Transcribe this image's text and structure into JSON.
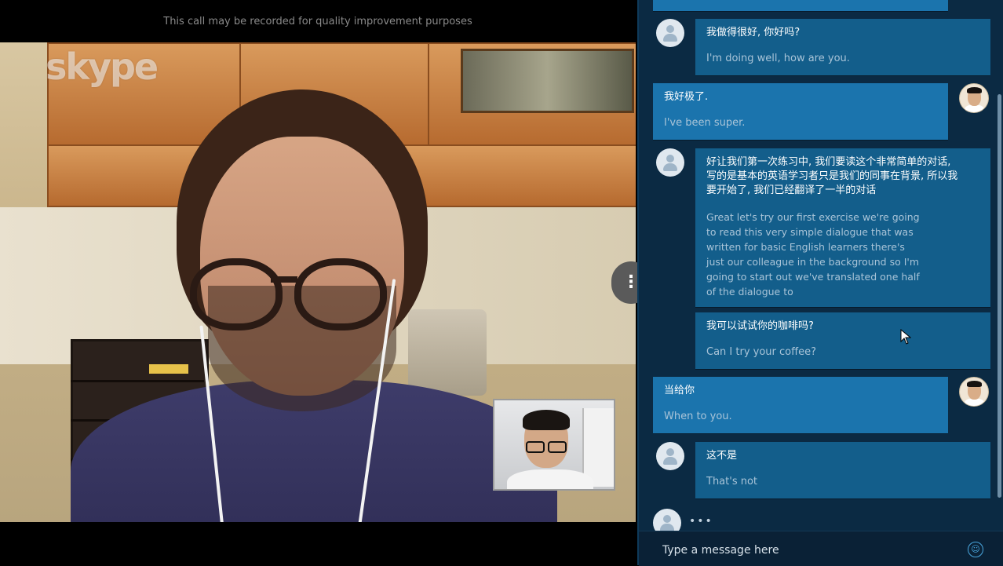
{
  "call": {
    "recording_notice": "This call may be recorded for quality improvement purposes",
    "watermark": "skype",
    "more_options_glyph": "⋮"
  },
  "chat": {
    "messages": [
      {
        "sender": "contact",
        "text": "我做得很好, 你好吗?",
        "translation": "I'm doing well, how are you."
      },
      {
        "sender": "self",
        "text": "我好极了.",
        "translation": "I've been super."
      },
      {
        "sender": "contact",
        "text": "好让我们第一次练习中, 我们要读这个非常简单的对话, 写的是基本的英语学习者只是我们的同事在背景, 所以我要开始了, 我们已经翻译了一半的对话",
        "translation": "Great let's try our first exercise we're going to read this very simple dialogue that was written for basic English learners there's just our colleague in the background so I'm going to start out we've translated one half of the dialogue to"
      },
      {
        "sender": "contact",
        "text": "我可以试试你的咖啡吗?",
        "translation": "Can I try your coffee?"
      },
      {
        "sender": "self",
        "text": "当给你",
        "translation": "When to you."
      },
      {
        "sender": "contact",
        "text": "这不是",
        "translation": "That's not"
      }
    ],
    "typing_indicator": "•••",
    "input": {
      "placeholder": "Type a message here",
      "value": ""
    },
    "emoji_glyph": "☺"
  },
  "colors": {
    "chat_background": "#0b2a43",
    "contact_bubble": "#135e8b",
    "self_bubble": "#1b74ad",
    "accent": "#4aa8e0"
  },
  "icons": [
    "more-vertical-icon",
    "default-avatar-icon",
    "user-photo-avatar",
    "smiley-icon",
    "mouse-cursor-icon"
  ]
}
